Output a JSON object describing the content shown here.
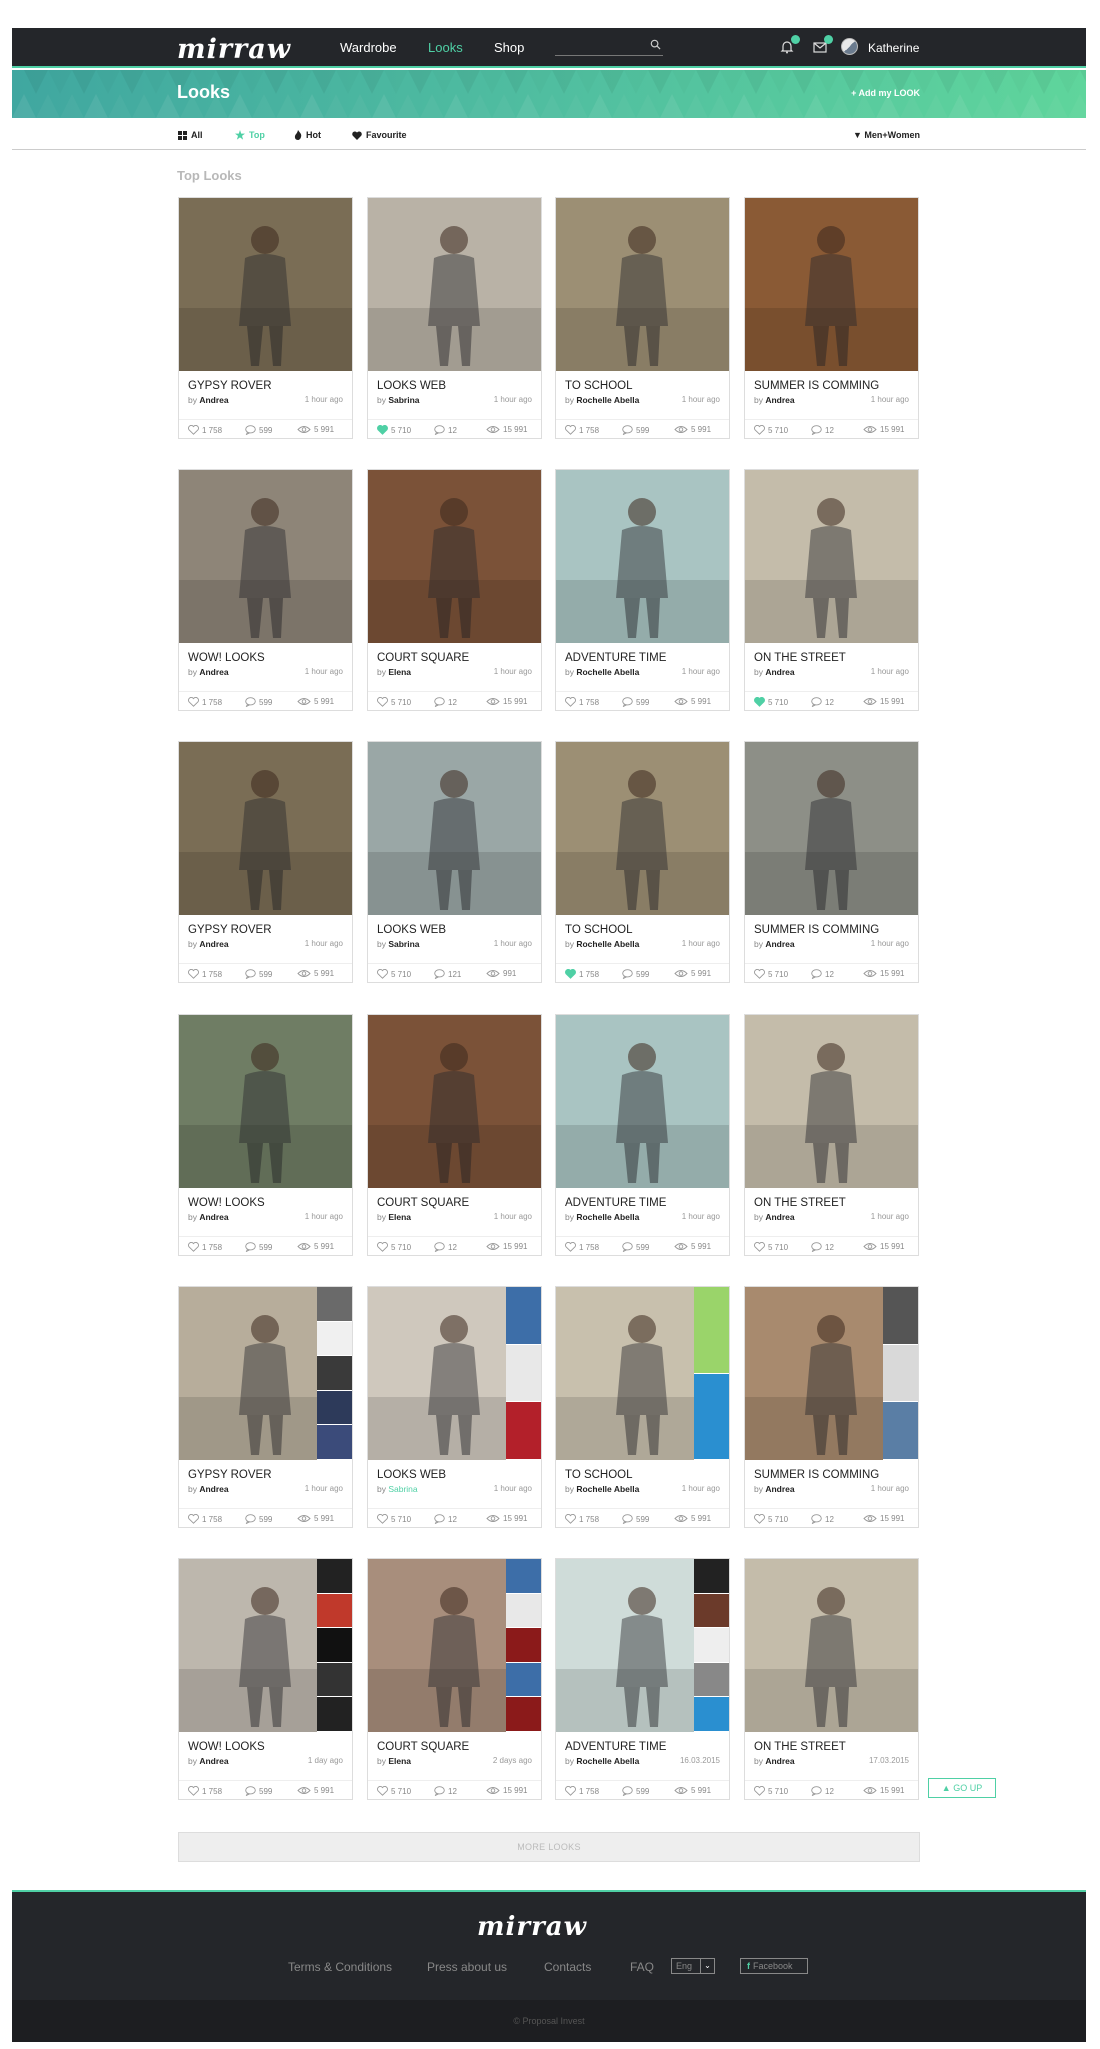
{
  "header": {
    "logo": "mirraw",
    "nav": [
      "Wardrobe",
      "Looks",
      "Shop"
    ],
    "active_nav": "Looks",
    "user": "Katherine",
    "icons": [
      "search-icon",
      "bell-icon",
      "mail-icon"
    ]
  },
  "banner": {
    "title": "Looks",
    "add_label": "+ Add my LOOK"
  },
  "filters": {
    "items": [
      {
        "label": "All",
        "icon": "grid-icon"
      },
      {
        "label": "Top",
        "icon": "star-icon"
      },
      {
        "label": "Hot",
        "icon": "flame-icon"
      },
      {
        "label": "Favourite",
        "icon": "heart-icon"
      }
    ],
    "active": "Top",
    "gender": "▼ Men+Women"
  },
  "section_title": "Top Looks",
  "cards": [
    {
      "title": "GYPSY ROVER",
      "by": "Andrea",
      "time": "1 hour ago",
      "likes": "1 758",
      "comments": "599",
      "views": "5 991",
      "liked": false,
      "photo": "#7a6d55"
    },
    {
      "title": "LOOKS WEB",
      "by": "Sabrina",
      "time": "1 hour ago",
      "likes": "5 710",
      "comments": "12",
      "views": "15 991",
      "liked": true,
      "photo": "#b9b2a6"
    },
    {
      "title": "TO SCHOOL",
      "by": "Rochelle Abella",
      "time": "1 hour ago",
      "likes": "1 758",
      "comments": "599",
      "views": "5 991",
      "liked": false,
      "photo": "#9c8f74"
    },
    {
      "title": "SUMMER IS COMMING",
      "by": "Andrea",
      "time": "1 hour ago",
      "likes": "5 710",
      "comments": "12",
      "views": "15 991",
      "liked": false,
      "photo": "#8a5a35"
    },
    {
      "title": "WOW! LOOKS",
      "by": "Andrea",
      "time": "1 hour ago",
      "likes": "1 758",
      "comments": "599",
      "views": "5 991",
      "liked": false,
      "photo": "#8e8578"
    },
    {
      "title": "COURT SQUARE",
      "by": "Elena",
      "time": "1 hour ago",
      "likes": "5 710",
      "comments": "12",
      "views": "15 991",
      "liked": false,
      "photo": "#7b5238"
    },
    {
      "title": "ADVENTURE TIME",
      "by": "Rochelle Abella",
      "time": "1 hour ago",
      "likes": "1 758",
      "comments": "599",
      "views": "5 991",
      "liked": false,
      "photo": "#a9c4c2"
    },
    {
      "title": "ON THE STREET",
      "by": "Andrea",
      "time": "1 hour ago",
      "likes": "5 710",
      "comments": "12",
      "views": "15 991",
      "liked": true,
      "photo": "#c4bcaa"
    },
    {
      "title": "GYPSY ROVER",
      "by": "Andrea",
      "time": "1 hour ago",
      "likes": "1 758",
      "comments": "599",
      "views": "5 991",
      "liked": false,
      "photo": "#7a6d55"
    },
    {
      "title": "LOOKS WEB",
      "by": "Sabrina",
      "time": "1 hour ago",
      "likes": "5 710",
      "comments": "121",
      "views": "991",
      "liked": false,
      "photo": "#9aa7a6"
    },
    {
      "title": "TO SCHOOL",
      "by": "Rochelle Abella",
      "time": "1 hour ago",
      "likes": "1 758",
      "comments": "599",
      "views": "5 991",
      "liked": true,
      "photo": "#9c8f74"
    },
    {
      "title": "SUMMER IS COMMING",
      "by": "Andrea",
      "time": "1 hour ago",
      "likes": "5 710",
      "comments": "12",
      "views": "15 991",
      "liked": false,
      "photo": "#8d8f87"
    },
    {
      "title": "WOW! LOOKS",
      "by": "Andrea",
      "time": "1 hour ago",
      "likes": "1 758",
      "comments": "599",
      "views": "5 991",
      "liked": false,
      "photo": "#6f7d64"
    },
    {
      "title": "COURT SQUARE",
      "by": "Elena",
      "time": "1 hour ago",
      "likes": "5 710",
      "comments": "12",
      "views": "15 991",
      "liked": false,
      "photo": "#7b5238"
    },
    {
      "title": "ADVENTURE TIME",
      "by": "Rochelle Abella",
      "time": "1 hour ago",
      "likes": "1 758",
      "comments": "599",
      "views": "5 991",
      "liked": false,
      "photo": "#a9c4c2"
    },
    {
      "title": "ON THE STREET",
      "by": "Andrea",
      "time": "1 hour ago",
      "likes": "5 710",
      "comments": "12",
      "views": "15 991",
      "liked": false,
      "photo": "#c4bcaa"
    },
    {
      "title": "GYPSY ROVER",
      "by": "Andrea",
      "time": "1 hour ago",
      "likes": "1 758",
      "comments": "599",
      "views": "5 991",
      "liked": false,
      "photo": "#b7ad9b",
      "items": [
        "#6a6a6a",
        "#f0f0f0",
        "#3a3a3a",
        "#2d3a5a",
        "#3b4b7a"
      ]
    },
    {
      "title": "LOOKS WEB",
      "by": "Sabrina",
      "time": "1 hour ago",
      "likes": "5 710",
      "comments": "12",
      "views": "15 991",
      "liked": false,
      "accent": true,
      "photo": "#cfc8bd",
      "items": [
        "#3d6ea8",
        "#e8e8e8",
        "#b3202a"
      ]
    },
    {
      "title": "TO SCHOOL",
      "by": "Rochelle Abella",
      "time": "1 hour ago",
      "likes": "1 758",
      "comments": "599",
      "views": "5 991",
      "liked": false,
      "photo": "#c8c0ad",
      "items": [
        "#9ad46a",
        "#2a8fd0"
      ]
    },
    {
      "title": "SUMMER IS COMMING",
      "by": "Andrea",
      "time": "1 hour ago",
      "likes": "5 710",
      "comments": "12",
      "views": "15 991",
      "liked": false,
      "photo": "#a88a6e",
      "items": [
        "#555",
        "#d9d9d9",
        "#5a7ea5"
      ]
    },
    {
      "title": "WOW! LOOKS",
      "by": "Andrea",
      "time": "1 day ago",
      "likes": "1 758",
      "comments": "599",
      "views": "5 991",
      "liked": false,
      "photo": "#bdb7ad",
      "items": [
        "#222",
        "#c0392b",
        "#111",
        "#333",
        "#222"
      ]
    },
    {
      "title": "COURT SQUARE",
      "by": "Elena",
      "time": "2 days ago",
      "likes": "5 710",
      "comments": "12",
      "views": "15 991",
      "liked": false,
      "photo": "#a88e7c",
      "items": [
        "#3d6ea8",
        "#e8e8e8",
        "#8b1a1a",
        "#3d6ea8",
        "#8b1a1a"
      ]
    },
    {
      "title": "ADVENTURE TIME",
      "by": "Rochelle Abella",
      "time": "16.03.2015",
      "likes": "1 758",
      "comments": "599",
      "views": "5 991",
      "liked": false,
      "photo": "#cfdcd9",
      "items": [
        "#222",
        "#6b3a2a",
        "#eee",
        "#888",
        "#2a8fd0"
      ]
    },
    {
      "title": "ON THE STREET",
      "by": "Andrea",
      "time": "17.03.2015",
      "likes": "5 710",
      "comments": "12",
      "views": "15 991",
      "liked": false,
      "photo": "#c4bcaa"
    }
  ],
  "go_up": "▲ GO UP",
  "more_looks": "MORE LOOKS",
  "footer": {
    "logo": "mirraw",
    "links": [
      "Terms & Conditions",
      "Press about us",
      "Contacts",
      "FAQ"
    ],
    "language": "Eng",
    "facebook": "Facebook",
    "copyright": "© Proposal Invest"
  }
}
